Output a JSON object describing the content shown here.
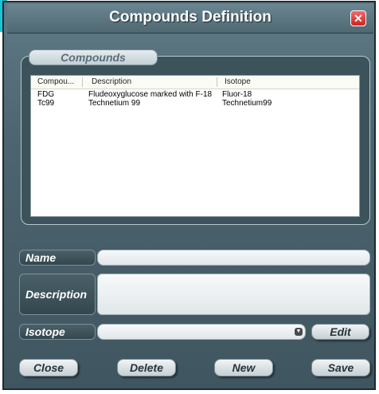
{
  "window": {
    "title": "Compounds Definition"
  },
  "group": {
    "label": "Compounds"
  },
  "table": {
    "columns": [
      "Compou...",
      "Description",
      "Isotope"
    ],
    "rows": [
      [
        "FDG",
        "Fludeoxyglucose marked with F-18",
        "Fluor-18"
      ],
      [
        "Tc99",
        "Technetium 99",
        "Technetium99"
      ]
    ]
  },
  "form": {
    "name_label": "Name",
    "name_value": "",
    "description_label": "Description",
    "description_value": "",
    "isotope_label": "Isotope",
    "isotope_value": "",
    "edit_label": "Edit"
  },
  "buttons": {
    "close": "Close",
    "delete": "Delete",
    "new": "New",
    "save": "Save"
  },
  "colors": {
    "accent": "#19c3d8",
    "close_button": "#e03030",
    "panel": "#4d6570"
  },
  "icons": {
    "close": "close-icon",
    "dropdown": "dropdown-arrow-icon"
  }
}
